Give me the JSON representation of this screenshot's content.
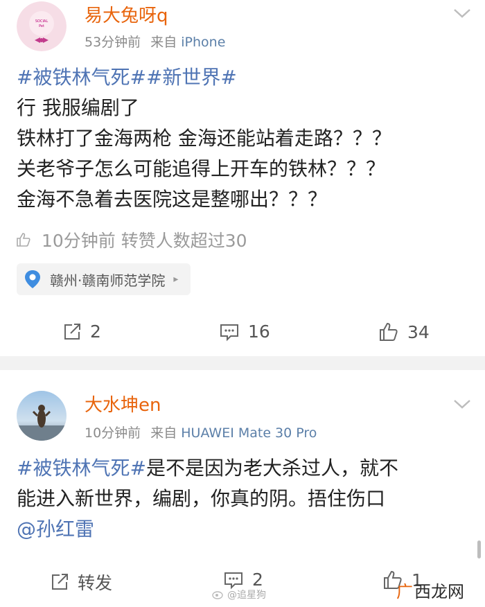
{
  "post1": {
    "username": "易大兔呀q",
    "time": "53分钟前",
    "source_prefix": "来自",
    "device": "iPhone",
    "body": {
      "tag1": "#被铁林气死#",
      "tag2": "#新世界#",
      "line2": "行 我服编剧了",
      "line3": "铁林打了金海两枪 金海还能站着走路？？？",
      "line4": "关老爷子怎么可能追得上开车的铁林？？？",
      "line5": "金海不急着去医院这是整哪出？？？"
    },
    "likes_info": "10分钟前 转赞人数超过30",
    "location": "赣州·赣南师范学院",
    "actions": {
      "repost": "2",
      "comment": "16",
      "like": "34"
    },
    "icons": [
      "pig-avatar-icon",
      "chevron-down-icon",
      "thumb-icon",
      "location-pin-icon",
      "repost-icon",
      "comment-icon",
      "like-icon"
    ]
  },
  "post2": {
    "username": "大水坤en",
    "time": "10分钟前",
    "source_prefix": "来自",
    "device": "HUAWEI Mate 30 Pro",
    "body": {
      "tag1": "#被铁林气死#",
      "line1_rest": "是不是因为老大杀过人，就不",
      "line2": "能进入新世界，编剧，你真的阴。捂住伤口",
      "mention": "@孙红雷"
    },
    "actions": {
      "repost": "转发",
      "comment": "2",
      "like": "1"
    }
  },
  "watermark": "@追星狗",
  "corner_logo": {
    "g": "广",
    "rest": "西龙网"
  },
  "colors": {
    "username": "#e8640c",
    "tag": "#4f74b4",
    "meta": "#8a8a8a",
    "device": "#5b7fa8"
  }
}
